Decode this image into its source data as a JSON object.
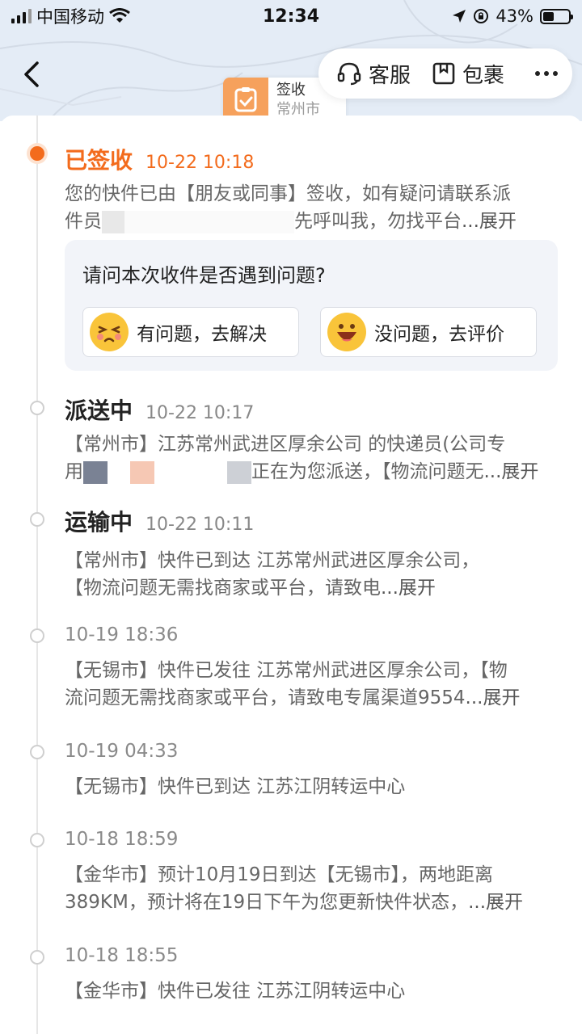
{
  "status_bar": {
    "carrier": "中国移动",
    "time": "12:34",
    "battery": "43%",
    "battery_level": 0.43
  },
  "header": {
    "sign_marker": {
      "title": "签收",
      "city": "常州市"
    },
    "pill": {
      "service_label": "客服",
      "package_label": "包裹"
    }
  },
  "question": {
    "text": "请问本次收件是否遇到问题?",
    "problem_label": "有问题，去解决",
    "no_problem_label": "没问题，去评价"
  },
  "events": [
    {
      "status": "已签收",
      "time": "10-22 10:18",
      "desc_line1": "您的快件已由【朋友或同事】签收，如有疑问请联系派",
      "desc_line2_prefix": "件员",
      "desc_line2_suffix": "先呼叫我，勿找平台",
      "expand": "...展开"
    },
    {
      "status": "派送中",
      "time": "10-22 10:17",
      "desc_line1": "【常州市】江苏常州武进区厚余公司 的快递员(公司专",
      "desc_line2_prefix": "用",
      "desc_line2_suffix": "正在为您派送，【物流问题无",
      "expand": "...展开"
    },
    {
      "status": "运输中",
      "time": "10-22 10:11",
      "desc_line1": "【常州市】快件已到达 江苏常州武进区厚余公司，",
      "desc_line2": "【物流问题无需找商家或平台，请致电",
      "expand": "...展开"
    },
    {
      "time": "10-19 18:36",
      "desc_line1": "【无锡市】快件已发往 江苏常州武进区厚余公司，【物",
      "desc_line2": "流问题无需找商家或平台，请致电专属渠道9554",
      "expand": "...展开"
    },
    {
      "time": "10-19 04:33",
      "desc_line1": "【无锡市】快件已到达 江苏江阴转运中心"
    },
    {
      "time": "10-18 18:59",
      "desc_line1": "【金华市】预计10月19日到达【无锡市】，两地距离",
      "desc_line2": "389KM，预计将在19日下午为您更新快件状态，",
      "expand": "...展开"
    },
    {
      "time": "10-18 18:55",
      "desc_line1": "【金华市】快件已发往 江苏江阴转运中心"
    }
  ],
  "colors": {
    "accent": "#f36b1c",
    "sign_marker": "#f6a15c",
    "emoji": "#f9c43a"
  }
}
